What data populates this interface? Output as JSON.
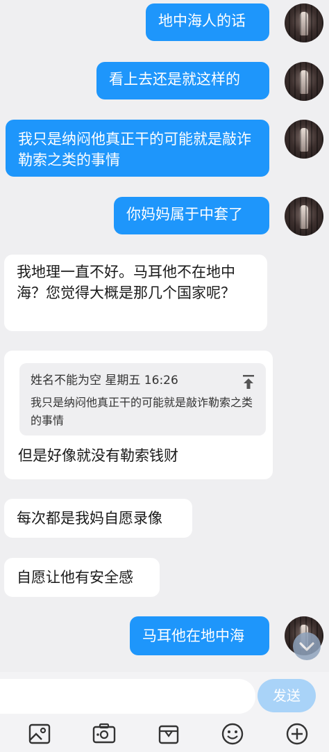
{
  "messages": [
    {
      "side": "out",
      "text": "地中海人的话"
    },
    {
      "side": "out",
      "text": "看上去还是就这样的"
    },
    {
      "side": "out",
      "text": "我只是纳闷他真正干的可能就是敲诈勒索之类的事情"
    },
    {
      "side": "out",
      "text": "你妈妈属于中套了"
    },
    {
      "side": "in",
      "text": "我地理一直不好。马耳他不在地中海？您觉得大概是那几个国家呢？"
    },
    {
      "side": "in",
      "quote": {
        "meta": "姓名不能为空  星期五 16:26",
        "text": "我只是纳闷他真正干的可能就是敲诈勒索之类的事情"
      },
      "text": "但是好像就没有勒索钱财"
    },
    {
      "side": "in",
      "text": "每次都是我妈自愿录像"
    },
    {
      "side": "in",
      "text": "自愿让他有安全感"
    },
    {
      "side": "out",
      "text": "马耳他在地中海"
    }
  ],
  "composer": {
    "placeholder": "",
    "send_label": "发送"
  },
  "toolbar": {
    "icons": [
      "image-icon",
      "camera-icon",
      "gift-icon",
      "emoji-icon",
      "plus-icon"
    ]
  },
  "colors": {
    "outgoing_bubble": "#1e96fb",
    "incoming_bubble": "#ffffff",
    "background": "#efeff1",
    "send_button": "#a9d3f8"
  }
}
